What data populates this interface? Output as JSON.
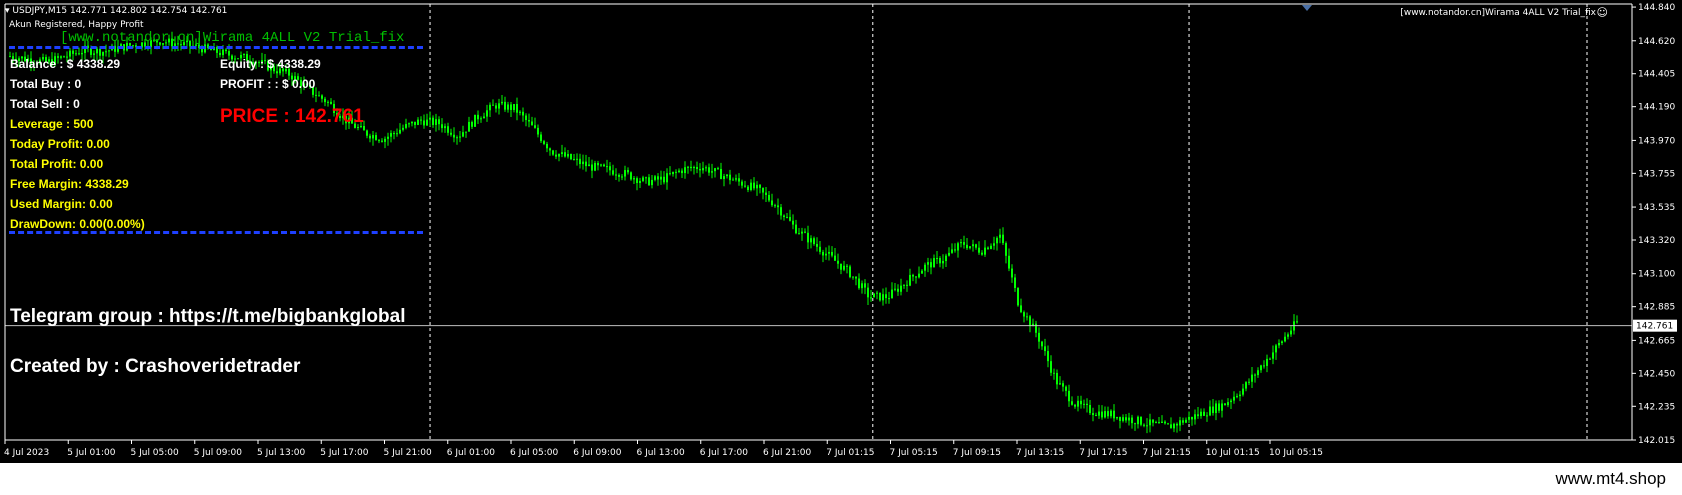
{
  "header": {
    "symbol_line": "USDJPY,M15  142.771 142.802 142.754 142.761",
    "status_line": "Akun Registered, Happy Profit",
    "indicator_label": "[www.notandor.cn]Wirama 4ALL V2 Trial_fix",
    "smiley_icon": "smiley-face-icon"
  },
  "watermark": "[www.notandor.cn]Wirama 4ALL V2 Trial_fix",
  "account": {
    "balance": "Balance : $ 4338.29",
    "equity": "Equity : $ 4338.29",
    "total_buy": "Total Buy  : 0",
    "profit": "PROFIT : : $ 0.00",
    "total_sell": "Total Sell  : 0",
    "price": "PRICE : 142.761",
    "leverage": "Leverage : 500",
    "today_profit": "Today Profit: 0.00",
    "total_profit": "Total Profit: 0.00",
    "free_margin": "Free Margin: 4338.29",
    "used_margin": "Used Margin: 0.00",
    "drawdown": "DrawDown: 0.00(0.00%)"
  },
  "telegram": "Telegram group : https://t.me/bigbankglobal",
  "created_by": "Created by : Crashoveridetrader",
  "footer": "www.mt4.shop",
  "colors": {
    "background": "#000000",
    "candle": "#00ff00",
    "grid": "#ffffff",
    "price_line": "#c0c0c0",
    "separator": "#1e40ff",
    "yellow_text": "#ffff00",
    "price_text": "#ff0000"
  },
  "chart_data": {
    "type": "candlestick",
    "symbol": "USDJPY",
    "timeframe": "M15",
    "current_price": 142.761,
    "ylim": [
      142.015,
      144.86
    ],
    "y_ticks": [
      "144.840",
      "144.620",
      "144.405",
      "144.190",
      "143.970",
      "143.755",
      "143.535",
      "143.320",
      "143.100",
      "142.885",
      "142.665",
      "142.450",
      "142.235",
      "142.015"
    ],
    "x_ticks": [
      "4 Jul 2023",
      "5 Jul 01:00",
      "5 Jul 05:00",
      "5 Jul 09:00",
      "5 Jul 13:00",
      "5 Jul 17:00",
      "5 Jul 21:00",
      "6 Jul 01:00",
      "6 Jul 05:00",
      "6 Jul 09:00",
      "6 Jul 13:00",
      "6 Jul 17:00",
      "6 Jul 21:00",
      "7 Jul 01:15",
      "7 Jul 05:15",
      "7 Jul 09:15",
      "7 Jul 13:15",
      "7 Jul 17:15",
      "7 Jul 21:15",
      "10 Jul 01:15",
      "10 Jul 05:15"
    ],
    "day_separators_after_tick": [
      "5 Jul 21:00",
      "7 Jul 01:15",
      "7 Jul 21:15"
    ],
    "path_x": [
      0,
      3,
      6,
      9,
      12,
      15,
      18,
      21,
      24,
      27,
      30,
      33,
      36,
      39,
      42,
      45,
      48,
      51,
      54,
      57,
      60,
      63,
      66,
      69,
      72,
      75,
      78,
      81,
      84,
      87,
      90,
      93,
      96,
      99,
      102,
      105,
      108,
      111,
      114,
      117,
      120,
      123,
      126,
      129,
      132,
      135,
      138,
      141,
      144,
      147,
      150,
      153,
      156,
      159,
      162,
      165,
      168,
      171,
      174,
      177,
      180,
      183,
      186,
      189,
      192,
      195,
      198,
      201,
      204,
      207
    ],
    "path_close": [
      144.52,
      144.5,
      144.48,
      144.52,
      144.56,
      144.55,
      144.58,
      144.6,
      144.62,
      144.6,
      144.58,
      144.55,
      144.52,
      144.5,
      144.44,
      144.4,
      144.3,
      144.22,
      144.1,
      144.02,
      143.98,
      144.05,
      144.1,
      144.08,
      144.0,
      144.12,
      144.2,
      144.18,
      144.05,
      143.9,
      143.85,
      143.8,
      143.78,
      143.75,
      143.7,
      143.72,
      143.78,
      143.8,
      143.75,
      143.7,
      143.65,
      143.55,
      143.4,
      143.3,
      143.2,
      143.1,
      142.95,
      142.95,
      143.05,
      143.15,
      143.2,
      143.3,
      143.25,
      143.35,
      142.9,
      142.7,
      142.4,
      142.25,
      142.2,
      142.18,
      142.15,
      142.12,
      142.1,
      142.15,
      142.2,
      142.25,
      142.35,
      142.5,
      142.65,
      142.8
    ]
  }
}
